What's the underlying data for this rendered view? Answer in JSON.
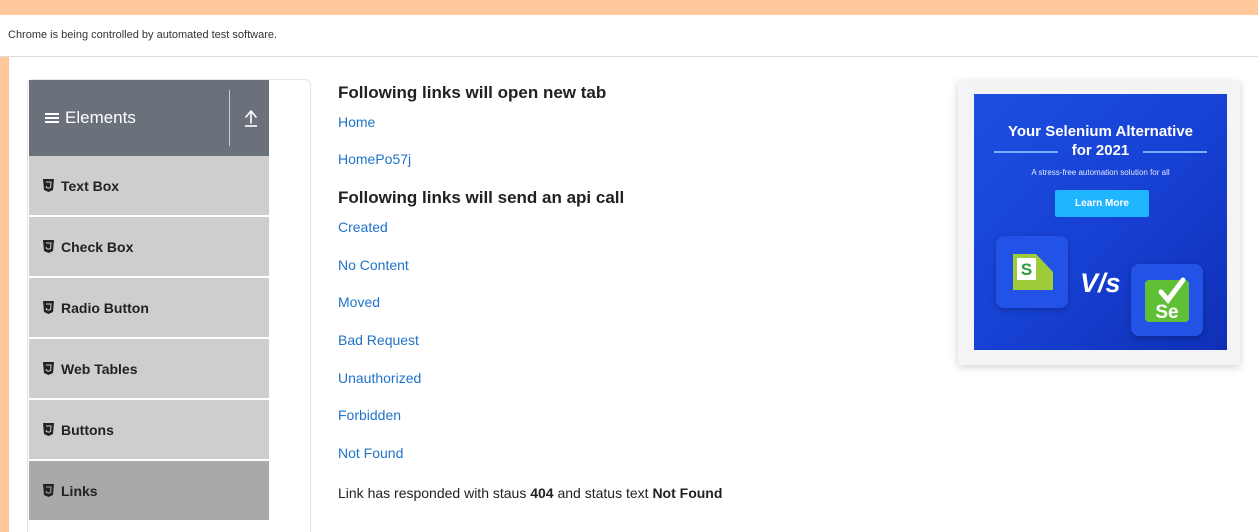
{
  "browser": {
    "automation_notice": "Chrome is being controlled by automated test software."
  },
  "sidebar": {
    "group_title": "Elements",
    "items": [
      {
        "label": "Text Box",
        "active": false
      },
      {
        "label": "Check Box",
        "active": false
      },
      {
        "label": "Radio Button",
        "active": false
      },
      {
        "label": "Web Tables",
        "active": false
      },
      {
        "label": "Buttons",
        "active": false
      },
      {
        "label": "Links",
        "active": true
      }
    ]
  },
  "main": {
    "new_tab_heading": "Following links will open new tab",
    "new_tab_links": [
      "Home",
      "HomePo57j"
    ],
    "api_heading": "Following links will send an api call",
    "api_links": [
      "Created",
      "No Content",
      "Moved",
      "Bad Request",
      "Unauthorized",
      "Forbidden",
      "Not Found"
    ],
    "response": {
      "prefix": "Link has responded with staus",
      "status_code": "404",
      "middle": "and status text",
      "status_text": "Not Found"
    }
  },
  "ad": {
    "title_line1": "Your Selenium Alternative",
    "title_line2": "for 2021",
    "tagline": "A stress-free automation solution for all",
    "button_label": "Learn More",
    "vs_label": "V/s",
    "left_logo_letter": "S",
    "right_logo_letters": "Se"
  },
  "colors": {
    "page_background": "#ffc89a",
    "link": "#1f73c9",
    "sidebar_header": "#6b717a",
    "menu_item": "#cecece",
    "menu_item_active": "#a9a9a9",
    "ad_blue": "#1d4fe0",
    "ad_button": "#1fb6ff"
  }
}
